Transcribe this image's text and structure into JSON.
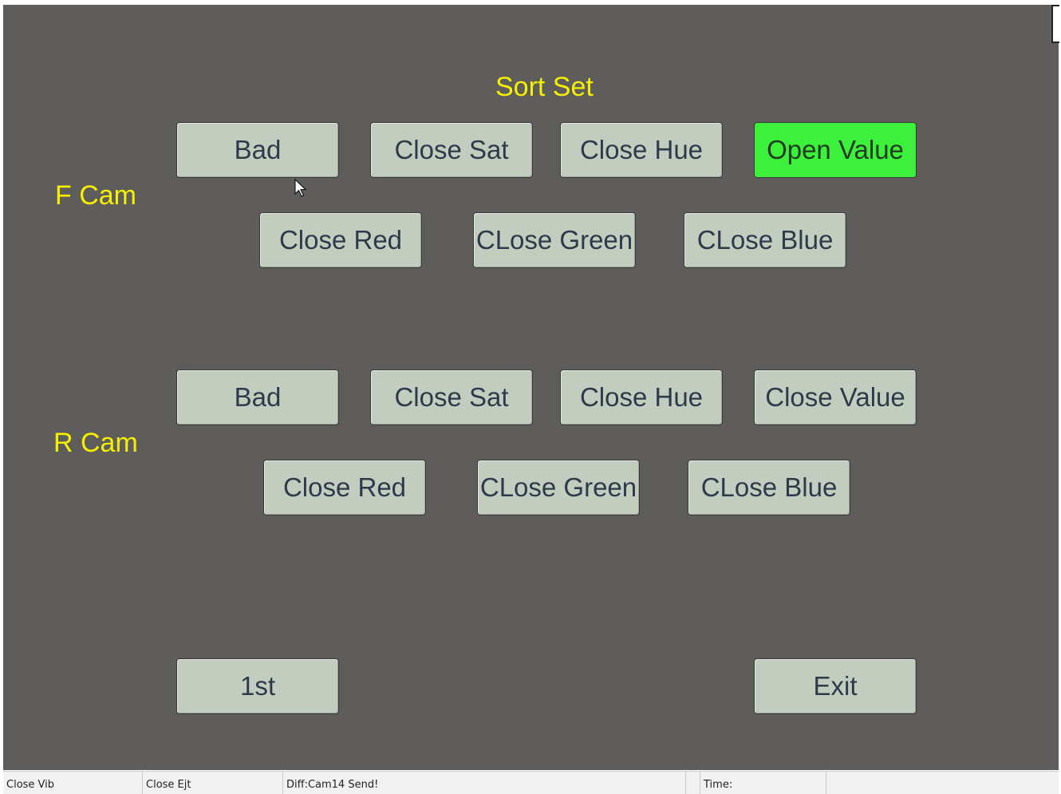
{
  "title": "Sort Set",
  "f_cam": {
    "label": "F Cam",
    "row1": [
      "Bad",
      "Close Sat",
      "Close Hue",
      "Open Value"
    ],
    "row2": [
      "Close Red",
      "CLose Green",
      "CLose Blue"
    ]
  },
  "r_cam": {
    "label": "R Cam",
    "row1": [
      "Bad",
      "Close Sat",
      "Close Hue",
      "Close Value"
    ],
    "row2": [
      "Close Red",
      "CLose Green",
      "CLose Blue"
    ]
  },
  "bottom": {
    "first": "1st",
    "exit": "Exit"
  },
  "statusbar": [
    "Close Vib",
    "Close Ejt",
    "Diff:Cam14  Send!",
    "",
    "Time:",
    ""
  ],
  "colors": {
    "background": "#5f5d5b",
    "label": "#f4f000",
    "button": "#c3cdbf",
    "active_button": "#3cf03c"
  },
  "icons": {
    "cursor": "mouse-pointer-icon"
  }
}
